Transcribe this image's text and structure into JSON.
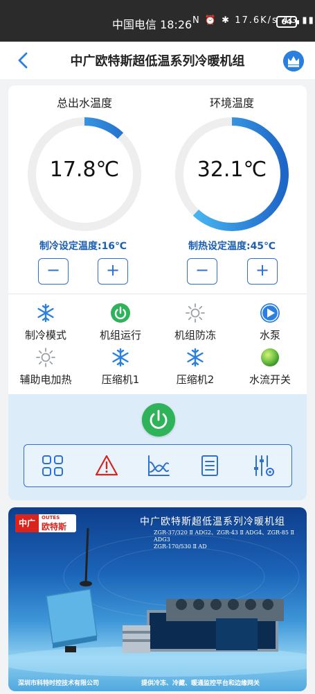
{
  "status_bar": {
    "carrier_time": "中国电信 18:26",
    "indicators": "N ⏰ ✱ 17.6K/s 4G ▮▮",
    "battery": "64"
  },
  "header": {
    "title": "中广欧特斯超低温系列冷暖机组"
  },
  "gauges": [
    {
      "title": "总出水温度",
      "value": "17.8℃",
      "level": 0.12,
      "setpoint_label": "制冷设定温度:16℃"
    },
    {
      "title": "环境温度",
      "value": "32.1℃",
      "level": 0.62,
      "setpoint_label": "制热设定温度:45℃"
    }
  ],
  "stepper": {
    "minus": "−",
    "plus": "+"
  },
  "status_items": [
    {
      "label": "制冷模式",
      "icon": "snowflake-icon",
      "color": "#2a7fe0"
    },
    {
      "label": "机组运行",
      "icon": "power-icon",
      "color": "#2fb35a"
    },
    {
      "label": "机组防冻",
      "icon": "sun-icon",
      "color": "#9aa0a6"
    },
    {
      "label": "水泵",
      "icon": "play-icon",
      "color": "#2a7fe0"
    },
    {
      "label": "辅助电加热",
      "icon": "sun-icon",
      "color": "#9aa0a6"
    },
    {
      "label": "压缩机1",
      "icon": "snowflake-icon",
      "color": "#2a7fe0"
    },
    {
      "label": "压缩机2",
      "icon": "snowflake-icon",
      "color": "#2a7fe0"
    },
    {
      "label": "水流开关",
      "icon": "green-ball-icon",
      "color": "#6cc040"
    }
  ],
  "toolbar": {
    "items": [
      "grid-icon",
      "warning-icon",
      "chart-icon",
      "list-icon",
      "settings-sliders-icon"
    ]
  },
  "banner": {
    "brand_short": "中广",
    "brand_en": "OUTES",
    "brand_cn": "欧特斯",
    "title": "中广欧特斯超低温系列冷暖机组",
    "models_line1": "ZGR-37/320 Ⅱ ADG2、ZGR-43 Ⅱ ADG4、ZGR-85 Ⅱ ADG3",
    "models_line2": "ZGR-170/530 Ⅱ AD",
    "footer_left": "深圳市科特时控技术有限公司",
    "footer_right": "提供冷冻、冷藏、暖通监控平台和边缘网关"
  },
  "colors": {
    "accent": "#2e6fd0",
    "gauge_track": "#eeeeee",
    "running_green": "#2fb35a",
    "alarm_red": "#d8241c"
  }
}
